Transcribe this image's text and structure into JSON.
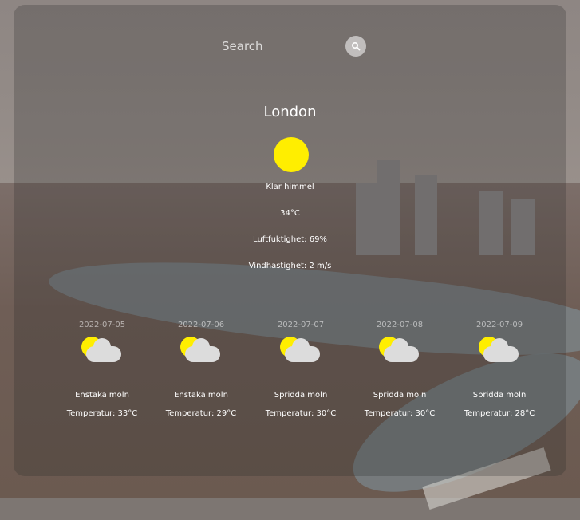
{
  "search": {
    "placeholder": "Search"
  },
  "current": {
    "city": "London",
    "description": "Klar himmel",
    "temperature": "34°C",
    "humidity": "Luftfuktighet: 69%",
    "wind": "Vindhastighet: 2 m/s",
    "icon": "sun-icon"
  },
  "forecast": [
    {
      "date": "2022-07-05",
      "description": "Enstaka moln",
      "temperature": "Temperatur: 33°C",
      "icon": "partly-cloudy-icon"
    },
    {
      "date": "2022-07-06",
      "description": "Enstaka moln",
      "temperature": "Temperatur: 29°C",
      "icon": "partly-cloudy-icon"
    },
    {
      "date": "2022-07-07",
      "description": "Spridda moln",
      "temperature": "Temperatur: 30°C",
      "icon": "partly-cloudy-icon"
    },
    {
      "date": "2022-07-08",
      "description": "Spridda moln",
      "temperature": "Temperatur: 30°C",
      "icon": "partly-cloudy-icon"
    },
    {
      "date": "2022-07-09",
      "description": "Spridda moln",
      "temperature": "Temperatur: 28°C",
      "icon": "partly-cloudy-icon"
    }
  ],
  "colors": {
    "sun": "#ffee00",
    "cloud": "#dcdcdc",
    "text": "#ffffff"
  }
}
